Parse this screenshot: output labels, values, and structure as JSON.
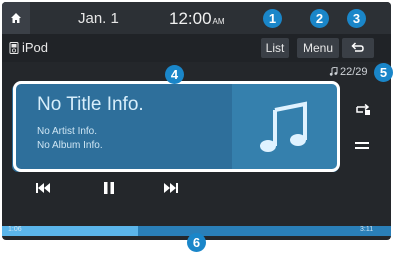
{
  "status_bar": {
    "date": "Jan.  1",
    "time": "12:00",
    "ampm": "AM"
  },
  "source": {
    "label": "iPod",
    "icon": "ipod-icon"
  },
  "header_buttons": {
    "list": "List",
    "menu": "Menu",
    "back_icon": "back-arrow-icon"
  },
  "track_counter": "22/29",
  "now_playing": {
    "title": "No Title Info.",
    "artist": "No Artist Info.",
    "album": "No Album Info.",
    "art_icon": "music-note-icon"
  },
  "controls": [
    "previous-icon",
    "pause-icon",
    "next-icon"
  ],
  "side_controls": [
    "repeat-icon",
    "shuffle-icon"
  ],
  "progress": {
    "elapsed": "1:06",
    "total": "3:11",
    "fraction": 0.35
  },
  "callouts": [
    "1",
    "2",
    "3",
    "4",
    "5",
    "6"
  ],
  "colors": {
    "accent": "#1a86c9",
    "cover": "#2e6f9b",
    "progress": "#5bb5ea"
  }
}
